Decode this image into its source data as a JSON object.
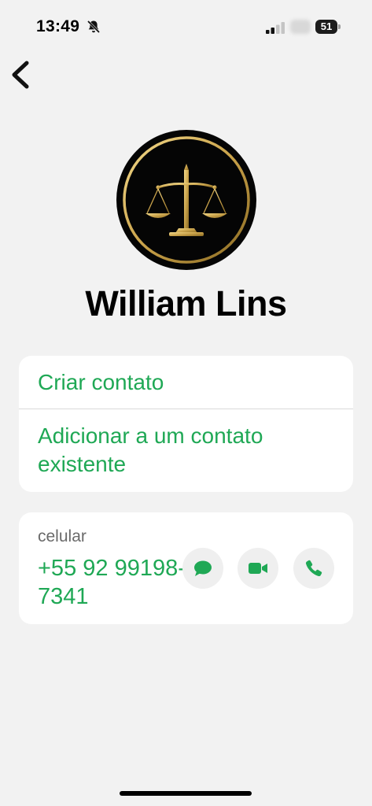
{
  "status_bar": {
    "time": "13:49",
    "battery": "51",
    "icons": [
      "bell-slash-icon",
      "signal-icon"
    ]
  },
  "nav": {
    "back_icon": "chevron-left-icon"
  },
  "contact": {
    "name": "William Lins",
    "avatar_icon": "scales-of-justice-icon"
  },
  "actions": {
    "create": "Criar contato",
    "add_existing": "Adicionar a um contato existente"
  },
  "phone": {
    "label": "celular",
    "number": "+55 92 99198-7341",
    "buttons": [
      "message-icon",
      "video-icon",
      "phone-icon"
    ]
  },
  "colors": {
    "accent": "#1fa855",
    "background": "#f2f2f2",
    "card": "#ffffff",
    "gold": "#c9a24a"
  }
}
